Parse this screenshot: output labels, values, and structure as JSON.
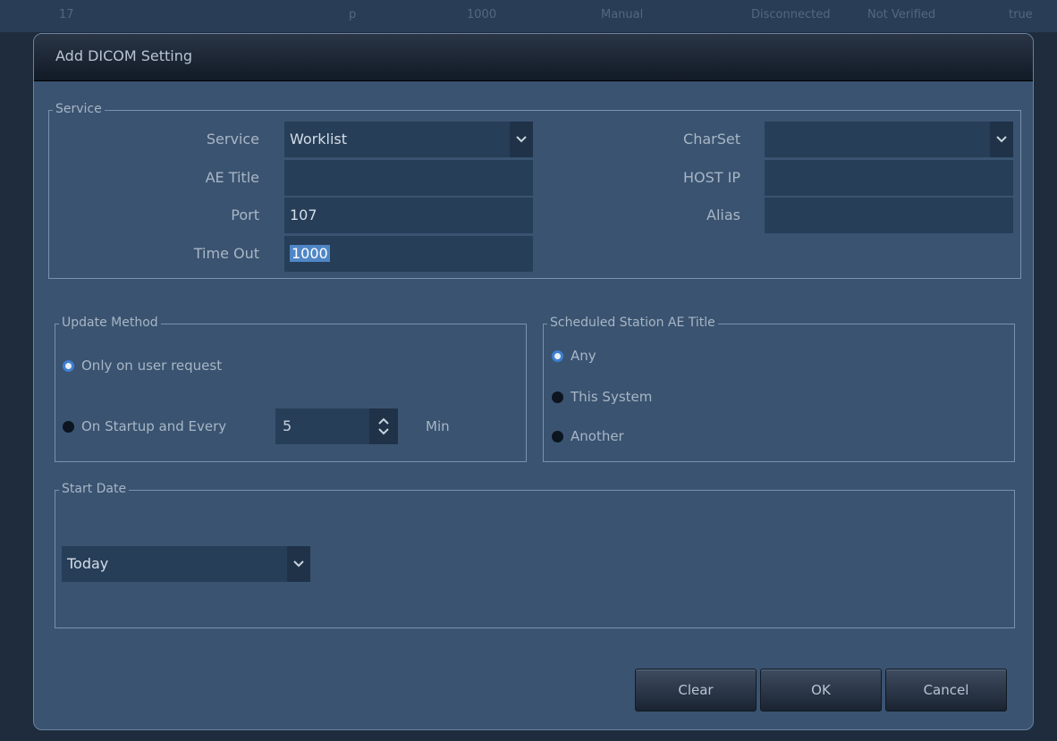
{
  "background_row": {
    "col1": "17",
    "col2": "p",
    "col3": "1000",
    "col4": "Manual",
    "col5": "Disconnected",
    "col6": "Not Verified",
    "col7": "true"
  },
  "dialog": {
    "title": "Add DICOM Setting",
    "service_group": {
      "legend": "Service",
      "service_label": "Service",
      "service_value": "Worklist",
      "ae_title_label": "AE Title",
      "ae_title_value": "",
      "port_label": "Port",
      "port_value": "107",
      "timeout_label": "Time Out",
      "timeout_value": "1000",
      "charset_label": "CharSet",
      "charset_value": "",
      "host_ip_label": "HOST IP",
      "host_ip_value": "",
      "alias_label": "Alias",
      "alias_value": ""
    },
    "update_method": {
      "legend": "Update Method",
      "option1": "Only on user request",
      "option2": "On Startup and Every",
      "interval_value": "5",
      "unit": "Min",
      "selected": "option1"
    },
    "scheduled_station": {
      "legend": "Scheduled Station AE Title",
      "option1": "Any",
      "option2": "This System",
      "option3": "Another",
      "selected": "option1"
    },
    "start_date": {
      "legend": "Start Date",
      "value": "Today"
    },
    "buttons": {
      "clear": "Clear",
      "ok": "OK",
      "cancel": "Cancel"
    }
  },
  "colors": {
    "dialog_bg": "#3a5370",
    "field_bg": "#273e58",
    "selection": "#4f86c6",
    "radio_selected": "#3e7fd0"
  },
  "icons": {
    "dropdown": "chevron-down-icon",
    "spin_up": "chevron-up-icon",
    "spin_down": "chevron-down-icon"
  }
}
